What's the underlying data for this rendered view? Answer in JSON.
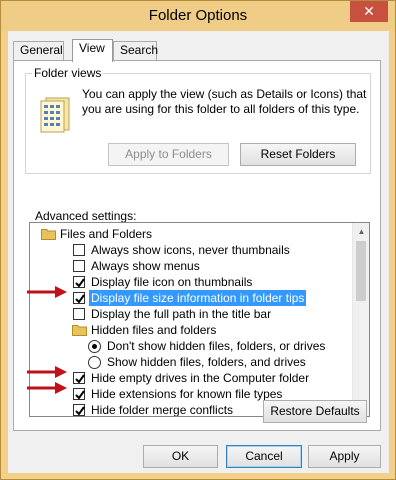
{
  "window": {
    "title": "Folder Options",
    "close_glyph": "✕"
  },
  "tabs": [
    {
      "label": "General",
      "active": false
    },
    {
      "label": "View",
      "active": true
    },
    {
      "label": "Search",
      "active": false
    }
  ],
  "folder_views": {
    "legend": "Folder views",
    "description": "You can apply the view (such as Details or Icons) that you are using for this folder to all folders of this type.",
    "apply_button": "Apply to Folders",
    "reset_button": "Reset Folders"
  },
  "advanced": {
    "label": "Advanced settings:",
    "items": [
      {
        "type": "folder",
        "label": "Files and Folders"
      },
      {
        "type": "checkbox",
        "label": "Always show icons, never thumbnails",
        "checked": false
      },
      {
        "type": "checkbox",
        "label": "Always show menus",
        "checked": false
      },
      {
        "type": "checkbox",
        "label": "Display file icon on thumbnails",
        "checked": true
      },
      {
        "type": "checkbox",
        "label": "Display file size information in folder tips",
        "checked": true,
        "selected": true,
        "arrow": true
      },
      {
        "type": "checkbox",
        "label": "Display the full path in the title bar",
        "checked": false
      },
      {
        "type": "folder",
        "label": "Hidden files and folders"
      },
      {
        "type": "radio",
        "label": "Don't show hidden files, folders, or drives",
        "checked": true
      },
      {
        "type": "radio",
        "label": "Show hidden files, folders, and drives",
        "checked": false
      },
      {
        "type": "checkbox",
        "label": "Hide empty drives in the Computer folder",
        "checked": true,
        "arrow": true
      },
      {
        "type": "checkbox",
        "label": "Hide extensions for known file types",
        "checked": true,
        "arrow": true
      },
      {
        "type": "checkbox",
        "label": "Hide folder merge conflicts",
        "checked": true
      }
    ]
  },
  "restore_button": "Restore Defaults",
  "footer": {
    "ok": "OK",
    "cancel": "Cancel",
    "apply": "Apply"
  },
  "colors": {
    "selection": "#3399ff",
    "annotation_arrow": "#c0101a",
    "title_bar": "#f0cd86"
  }
}
